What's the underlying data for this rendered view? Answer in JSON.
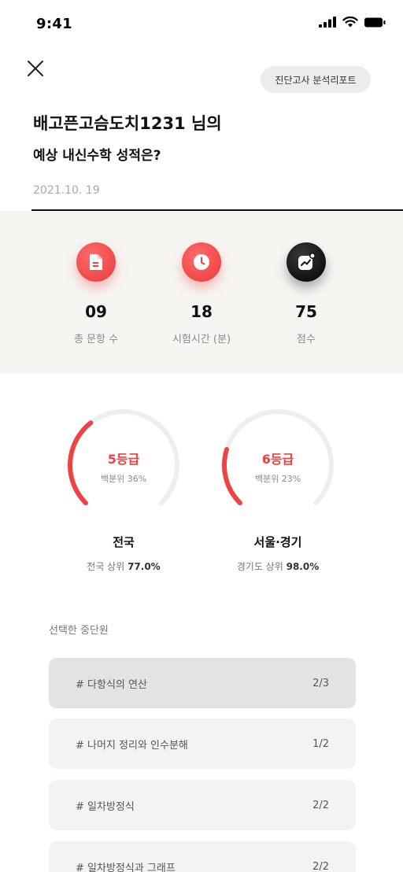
{
  "status_bar": {
    "time": "9:41"
  },
  "header": {
    "report_button": "진단고사 분석리포트",
    "title_line1": "배고픈고슴도치1231 님의",
    "title_line2": "예상 내신수학 성적은?",
    "date": "2021.10. 19"
  },
  "stats": [
    {
      "icon": "document-icon",
      "value": "09",
      "label": "총 문항 수",
      "color": "#f04848"
    },
    {
      "icon": "clock-icon",
      "value": "18",
      "label": "시험시간 (분)",
      "color": "#f04848"
    },
    {
      "icon": "chart-trend-icon",
      "value": "75",
      "label": "점수",
      "color": "#111111"
    }
  ],
  "regions": [
    {
      "grade": "5등급",
      "percentile_text": "백분위 36%",
      "percentile": 36,
      "name": "전국",
      "rank_prefix": "전국 상위 ",
      "rank_value": "77.0%"
    },
    {
      "grade": "6등급",
      "percentile_text": "백분위 23%",
      "percentile": 23,
      "name": "서울·경기",
      "rank_prefix": "경기도 상위 ",
      "rank_value": "98.0%"
    }
  ],
  "units_title": "선택한 중단원",
  "units": [
    {
      "name": "# 다항식의 연산",
      "score": "2/3",
      "active": true
    },
    {
      "name": "# 나머지 정리와 인수분해",
      "score": "1/2",
      "active": false
    },
    {
      "name": "# 일차방정식",
      "score": "2/2",
      "active": false
    },
    {
      "name": "# 일차방정식과 그래프",
      "score": "2/2",
      "active": false
    }
  ],
  "colors": {
    "accent": "#ef4343",
    "track": "#eeeeee",
    "panel": "#f6f5f2"
  }
}
